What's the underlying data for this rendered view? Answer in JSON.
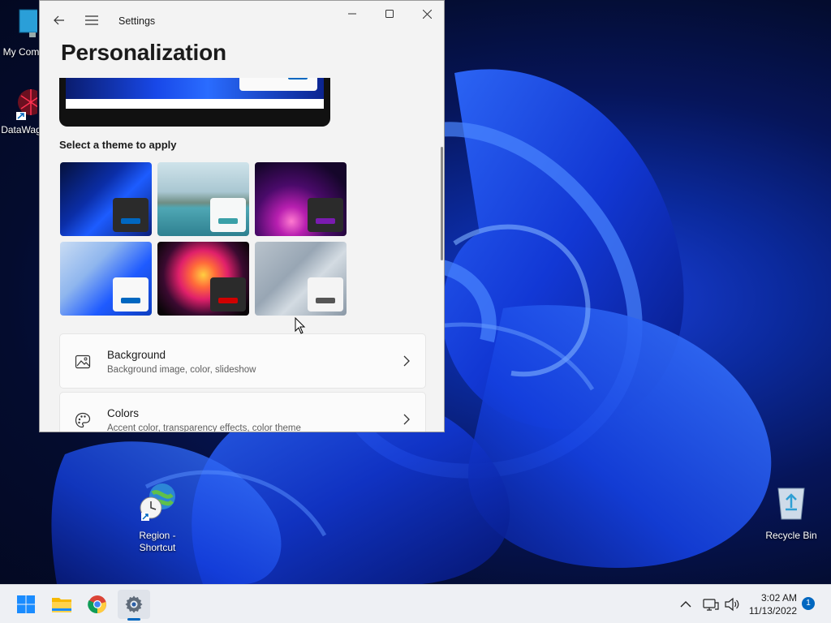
{
  "window": {
    "app_title": "Settings",
    "page_title": "Personalization",
    "section_label": "Select a theme to apply"
  },
  "themes": [
    {
      "name": "windows-light-bloom",
      "accent": "#0067c0"
    },
    {
      "name": "glow-lake",
      "accent": "#2aa198"
    },
    {
      "name": "captured-motion-purple",
      "accent": "#6a0dad"
    },
    {
      "name": "windows-bloom-light",
      "accent": "#0067c0"
    },
    {
      "name": "flow-flower",
      "accent": "#d00000"
    },
    {
      "name": "sunrise-gray",
      "accent": "#555555"
    }
  ],
  "settings": [
    {
      "title": "Background",
      "subtitle": "Background image, color, slideshow",
      "icon": "image-icon"
    },
    {
      "title": "Colors",
      "subtitle": "Accent color, transparency effects, color theme",
      "icon": "palette-icon"
    }
  ],
  "desktop": {
    "icons": [
      {
        "label": "My Com",
        "icon": "computer-icon"
      },
      {
        "label": "DataWag",
        "icon": "datawag-icon"
      },
      {
        "label_line1": "Region -",
        "label_line2": "Shortcut",
        "icon": "globe-clock-icon"
      },
      {
        "label": "Recycle Bin",
        "icon": "recycle-bin-icon"
      }
    ]
  },
  "taskbar": {
    "time": "3:02 AM",
    "date": "11/13/2022",
    "notification_count": "1",
    "apps": [
      "start-icon",
      "file-explorer-icon",
      "chrome-icon",
      "settings-icon"
    ]
  },
  "colors": {
    "accent": "#0067c0",
    "window_bg": "#f3f3f3",
    "card_bg": "#fbfbfb"
  }
}
